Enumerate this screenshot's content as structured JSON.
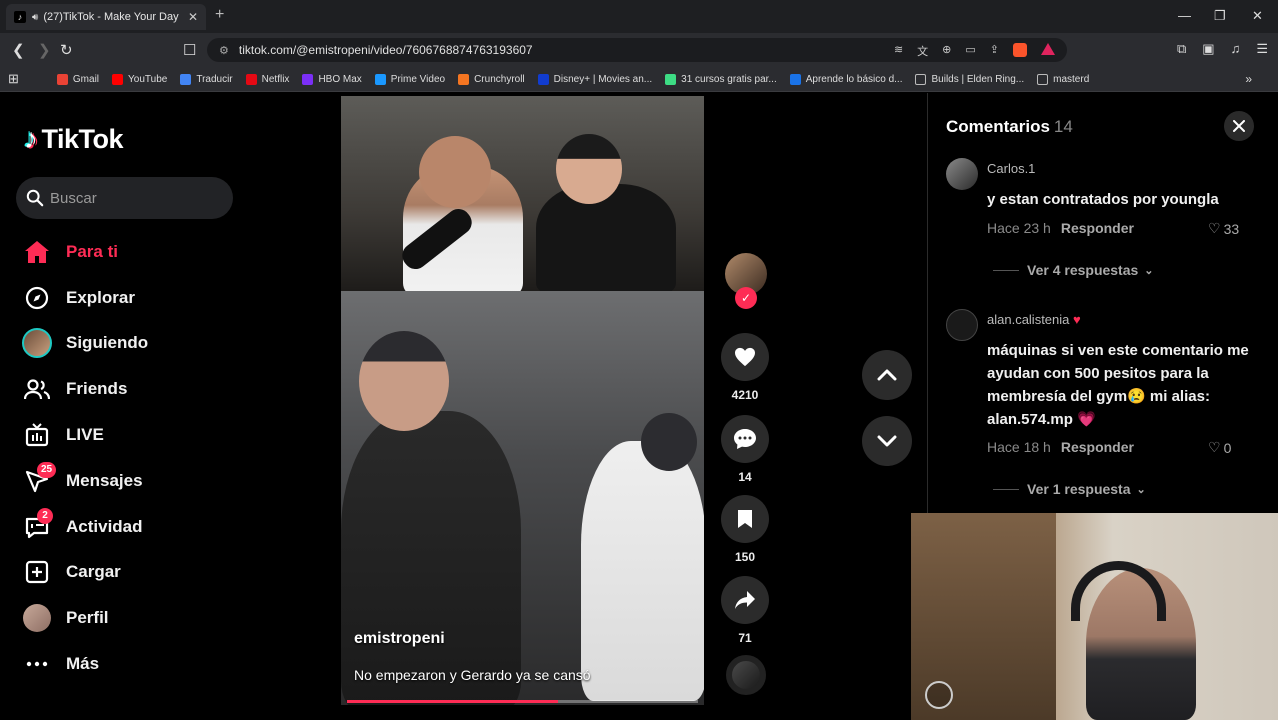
{
  "browser": {
    "tab_title": "(27)TikTok - Make Your Day",
    "url": "tiktok.com/@emistropeni/video/7606768874763193607",
    "bookmarks": [
      "Gmail",
      "YouTube",
      "Traducir",
      "Netflix",
      "HBO Max",
      "Prime Video",
      "Crunchyroll",
      "Disney+ | Movies an...",
      "31 cursos gratis par...",
      "Aprende lo básico d...",
      "Builds | Elden Ring...",
      "masterd"
    ],
    "bookmark_colors": [
      "#ea4335",
      "#ff0000",
      "#4285f4",
      "#e50914",
      "#7b2ff7",
      "#1a98ff",
      "#f47521",
      "#113ccf",
      "#3ddc84",
      "#1a73e8",
      "#2b2c30",
      "#2b2c30"
    ]
  },
  "brand": {
    "name": "TikTok",
    "accent": "#fe2c55"
  },
  "search": {
    "placeholder": "Buscar"
  },
  "nav": [
    {
      "label": "Para ti",
      "icon": "home-icon",
      "active": true
    },
    {
      "label": "Explorar",
      "icon": "compass-icon"
    },
    {
      "label": "Siguiendo",
      "icon": "following-avatar"
    },
    {
      "label": "Friends",
      "icon": "friends-icon"
    },
    {
      "label": "LIVE",
      "icon": "live-icon"
    },
    {
      "label": "Mensajes",
      "icon": "messages-icon",
      "badge": "25"
    },
    {
      "label": "Actividad",
      "icon": "activity-icon",
      "badge": "2"
    },
    {
      "label": "Cargar",
      "icon": "upload-icon"
    },
    {
      "label": "Perfil",
      "icon": "profile-avatar"
    },
    {
      "label": "Más",
      "icon": "more-icon"
    }
  ],
  "video": {
    "author": "emistropeni",
    "caption": "No empezaron y Gerardo ya se cansó",
    "progress": 0.6
  },
  "actions": {
    "likes": "4210",
    "comments": "14",
    "saves": "150",
    "shares": "71"
  },
  "comments_panel": {
    "title": "Comentarios",
    "count": "14",
    "items": [
      {
        "user": "Carlos.1",
        "text": "y estan contratados por youngla",
        "time": "Hace 23 h",
        "reply": "Responder",
        "likes": "33",
        "replies": "Ver 4 respuestas"
      },
      {
        "user": "alan.calistenia",
        "text": "máquinas si ven este comentario me ayudan con 500 pesitos para la membresía del gym😢 mi alias: alan.574.mp 💗",
        "time": "Hace 18 h",
        "reply": "Responder",
        "likes": "0",
        "replies": "Ver 1 respuesta"
      }
    ]
  }
}
